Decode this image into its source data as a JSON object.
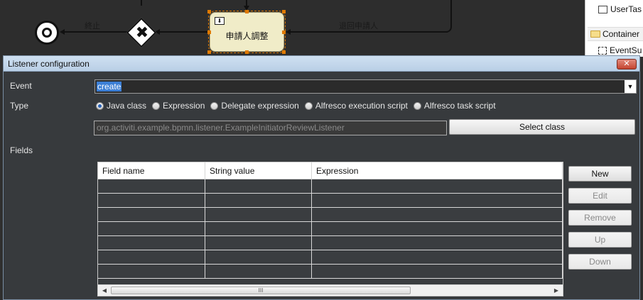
{
  "canvas": {
    "flow_label_end": "終止",
    "flow_label_back": "退回申請人",
    "task_label": "申請人調整"
  },
  "palette": {
    "items": [
      {
        "label": "UserTas",
        "icon": "user-task-icon"
      },
      {
        "label": "Container",
        "icon": "folder-icon"
      },
      {
        "label": "EventSu",
        "icon": "event-subprocess-icon"
      }
    ]
  },
  "dialog": {
    "title": "Listener configuration",
    "close_label": "✕",
    "event_label": "Event",
    "event_value": "create",
    "type_label": "Type",
    "type_options": [
      {
        "label": "Java class",
        "selected": true
      },
      {
        "label": "Expression",
        "selected": false
      },
      {
        "label": "Delegate expression",
        "selected": false
      },
      {
        "label": "Alfresco execution script",
        "selected": false
      },
      {
        "label": "Alfresco task script",
        "selected": false
      }
    ],
    "class_value": "org.activiti.example.bpmn.listener.ExampleInitiatorReviewListener",
    "select_class_label": "Select class",
    "fields_label": "Fields",
    "table": {
      "columns": [
        "Field name",
        "String value",
        "Expression"
      ],
      "rows": [
        [
          "",
          "",
          ""
        ],
        [
          "",
          "",
          ""
        ],
        [
          "",
          "",
          ""
        ],
        [
          "",
          "",
          ""
        ],
        [
          "",
          "",
          ""
        ],
        [
          "",
          "",
          ""
        ],
        [
          "",
          "",
          ""
        ]
      ],
      "scroll_thumb": "III"
    },
    "buttons": {
      "new": "New",
      "edit": "Edit",
      "remove": "Remove",
      "up": "Up",
      "down": "Down"
    }
  },
  "colors": {
    "dialog_bg": "#373a3d",
    "titlebar": "#cfe0f1",
    "selection": "#3c7fd6",
    "task_fill": "#f0ecc8",
    "selection_handles": "#e07a00"
  }
}
